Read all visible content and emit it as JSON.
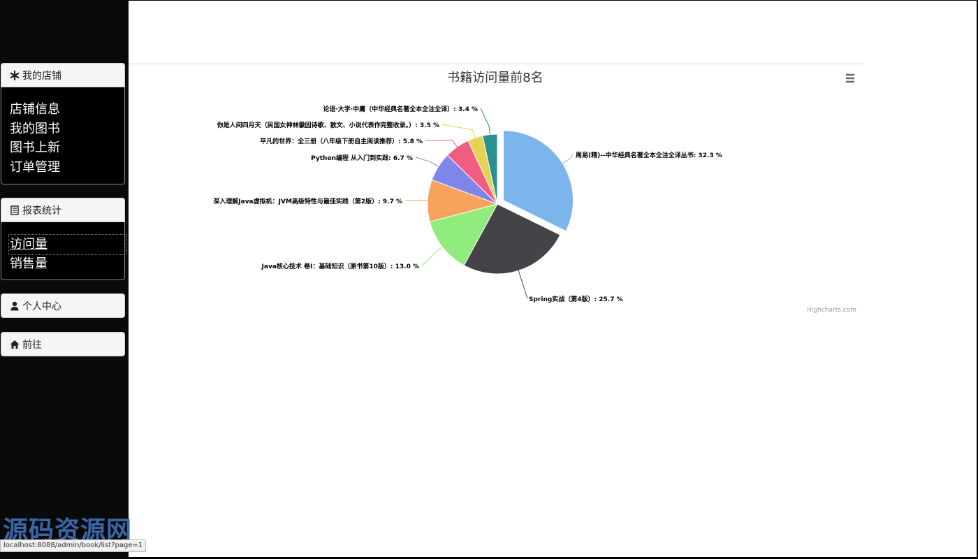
{
  "sidebar": {
    "groups": [
      {
        "icon": "asterisk-icon",
        "title": "我的店铺",
        "items": [
          "店铺信息",
          "我的图书",
          "图书上新",
          "订单管理"
        ]
      },
      {
        "icon": "list-icon",
        "title": "报表统计",
        "items": [
          "访问量",
          "销售量"
        ]
      },
      {
        "icon": "user-icon",
        "title": "个人中心"
      },
      {
        "icon": "home-icon",
        "title": "前往"
      }
    ]
  },
  "chart_data": {
    "type": "pie",
    "title": "书籍访问量前8名",
    "credits": "Highcharts.com",
    "menu_icon": "hamburger-icon",
    "slices": [
      {
        "name": "周易(精)--中华经典名著全本全注全译丛书",
        "value": 32.3,
        "color": "#7cb5ec",
        "sliced": true
      },
      {
        "name": "Spring实战（第4版）",
        "value": 25.7,
        "color": "#434348"
      },
      {
        "name": "Java核心技术 卷I：基础知识（原书第10版）",
        "value": 13.0,
        "color": "#90ed7d"
      },
      {
        "name": "深入理解Java虚拟机：JVM高级特性与最佳实践（第2版）",
        "value": 9.7,
        "color": "#f7a35c"
      },
      {
        "name": "Python编程 从入门到实践",
        "value": 6.7,
        "color": "#8085e9"
      },
      {
        "name": "平凡的世界：全三册（八年级下册自主阅读推荐）",
        "value": 5.8,
        "color": "#f15c80"
      },
      {
        "name": "你是人间四月天（民国女神林徽因诗歌、散文、小说代表作完整收录。）",
        "value": 3.5,
        "color": "#e4d354"
      },
      {
        "name": "论语·大学·中庸（中华经典名著全本全注全译）",
        "value": 3.4,
        "color": "#2b908f"
      }
    ],
    "labels": [
      "周易(精)--中华经典名著全本全注全译丛书: 32.3 %",
      "Spring实战（第4版）: 25.7 %",
      "Java核心技术 卷I：基础知识（原书第10版）: 13.0 %",
      "深入理解Java虚拟机：JVM高级特性与最佳实践（第2版）: 9.7 %",
      "Python编程 从入门到实践: 6.7 %",
      "平凡的世界：全三册（八年级下册自主阅读推荐）: 5.8 %",
      "你是人间四月天（民国女神林徽因诗歌、散文、小说代表作完整收录。）: 3.5 %",
      "论语·大学·中庸（中华经典名著全本全注全译）: 3.4 %"
    ]
  },
  "status_url": "localhost:8088/admin/book/list?page=1",
  "watermark": "源码资源网"
}
